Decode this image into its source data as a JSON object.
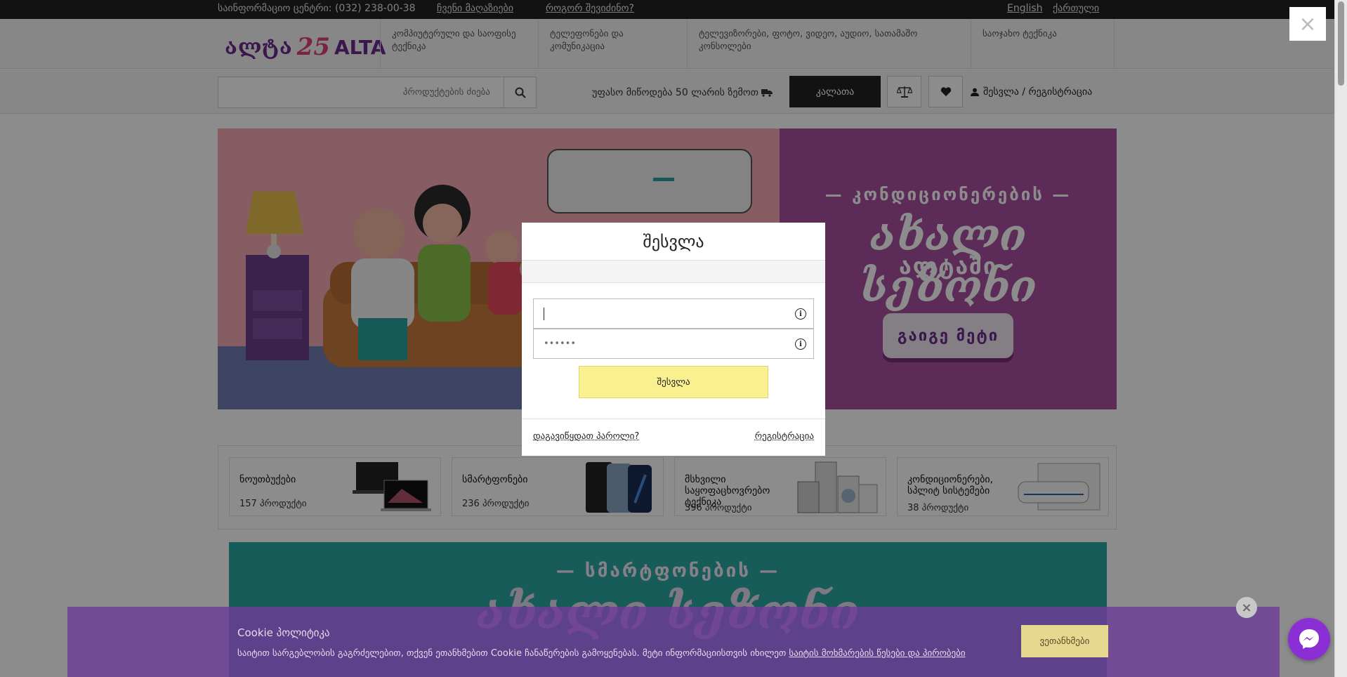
{
  "topbar": {
    "info": "საინფორმაციო ცენტრი: (032) 238-00-38",
    "stores": "ჩვენი მაღაზიები",
    "how_to_buy": "როგორ შევიძინო?",
    "lang_en": "English",
    "lang_ka": "ქართული"
  },
  "header": {
    "logo_geo": "ალტა",
    "logo_25": "25",
    "logo_latin": "ALTA",
    "categories": [
      {
        "label": "კომპიუტერული და საოფისე ტექნიკა"
      },
      {
        "label": "ტელეფონები და კომუნიკაცია"
      },
      {
        "label": "ტელევიზორები, ფოტო, ვიდეო, აუდიო, სათამაშო კონსოლები"
      },
      {
        "label": "საოჯახო ტექნიკა"
      }
    ]
  },
  "search": {
    "placeholder": "პროდუქტების ძიება",
    "delivery": "უფასო მიწოდება 50 ლარის ზემოთ",
    "cart": "კალათა",
    "login": "შესვლა / რეგისტრაცია"
  },
  "banner": {
    "line1": "— კონდიციონერების —",
    "line2": "ახალი სეზონი",
    "line3": "ალტაში",
    "button": "გაიგე მეტი"
  },
  "cards": [
    {
      "title": "ნოუთბუქები",
      "count": "157 პროდუქტი"
    },
    {
      "title": "სმარტფონები",
      "count": "236 პროდუქტი"
    },
    {
      "title": "მსხვილი საყოფაცხოვრებო ტექნიკა",
      "count": "396 პროდუქტი"
    },
    {
      "title": "კონდიციონერები, სპლიტ სისტემები",
      "count": "38 პროდუქტი"
    }
  ],
  "banner2": {
    "line1": "— სმარტფონების —",
    "line2": "ახალი სეზონი"
  },
  "modal": {
    "title": "შესვლა",
    "username_value": "",
    "password_placeholder": "••••••",
    "submit": "შესვლა",
    "forgot": "დაგავიწყდათ პაროლი?",
    "register": "რეგისტრაცია"
  },
  "cookie": {
    "title": "Cookie პოლიტიკა",
    "text": "საიტით სარგებლობის გაგრძელებით, თქვენ ეთანხმებით Cookie ჩანაწერების გამოყენებას. მეტი ინფორმაციისთვის იხილეთ ",
    "policy_link": "საიტის მოხმარების წესები და პირობები",
    "accept": "ვეთანხმები"
  },
  "close_symbol": "×",
  "icons": [
    "search-icon",
    "truck-icon",
    "scales-icon",
    "heart-icon",
    "user-icon",
    "info-icon",
    "close-icon",
    "messenger-icon"
  ],
  "colors": {
    "brand_purple": "#6a2b8b",
    "submit_yellow": "#fbf08f",
    "cookie_bar": "#6e3c96",
    "messenger": "#8b2ed6"
  }
}
